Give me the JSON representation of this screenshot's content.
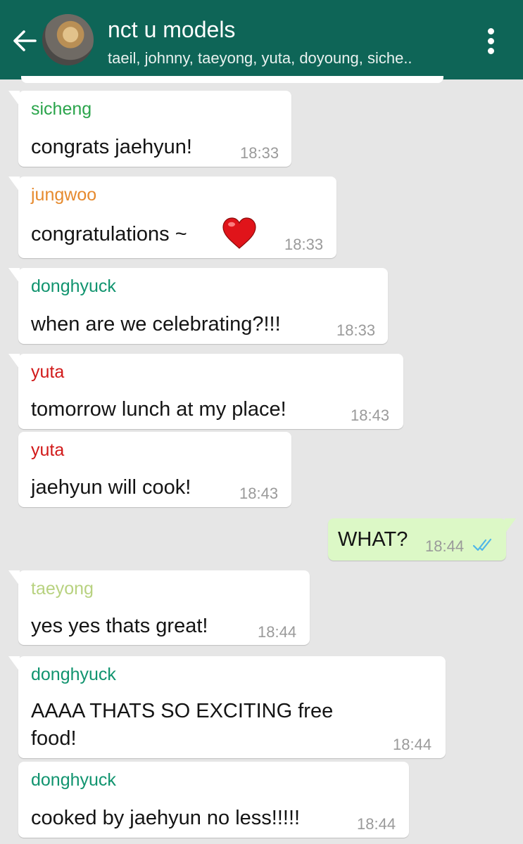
{
  "header": {
    "title": "nct u models",
    "members": "taeil, johnny, taeyong, yuta, doyoung, siche..",
    "colors": {
      "bar": "#0e6557"
    }
  },
  "icons": {
    "back": "back-arrow-icon",
    "menu": "more-vert-icon",
    "heart": "red-heart-emoji",
    "read": "double-check-icon"
  },
  "colors": {
    "sicheng": "#2aa44b",
    "jungwoo": "#e68a2e",
    "donghyuck": "#11946f",
    "yuta": "#d11919",
    "taeyong": "#b8d280",
    "read_ticks": "#4fb6e8",
    "outgoing": "#dcf8c6"
  },
  "messages": [
    {
      "sender": "sicheng",
      "text": "congrats jaehyun!",
      "time": "18:33"
    },
    {
      "sender": "jungwoo",
      "text": "congratulations ~",
      "time": "18:33",
      "emoji": "heart"
    },
    {
      "sender": "donghyuck",
      "text": "when are we celebrating?!!!",
      "time": "18:33"
    },
    {
      "sender": "yuta",
      "text": "tomorrow lunch at my place!",
      "time": "18:43"
    },
    {
      "sender": "yuta",
      "text": "jaehyun will cook!",
      "time": "18:43"
    },
    {
      "outgoing": true,
      "text": "WHAT?",
      "time": "18:44",
      "status": "read"
    },
    {
      "sender": "taeyong",
      "text": "yes yes thats great!",
      "time": "18:44"
    },
    {
      "sender": "donghyuck",
      "text": "AAAA THATS SO EXCITING free",
      "text2": "food!",
      "time": "18:44"
    },
    {
      "sender": "donghyuck",
      "text": "cooked by jaehyun no less!!!!!",
      "time": "18:44"
    }
  ]
}
